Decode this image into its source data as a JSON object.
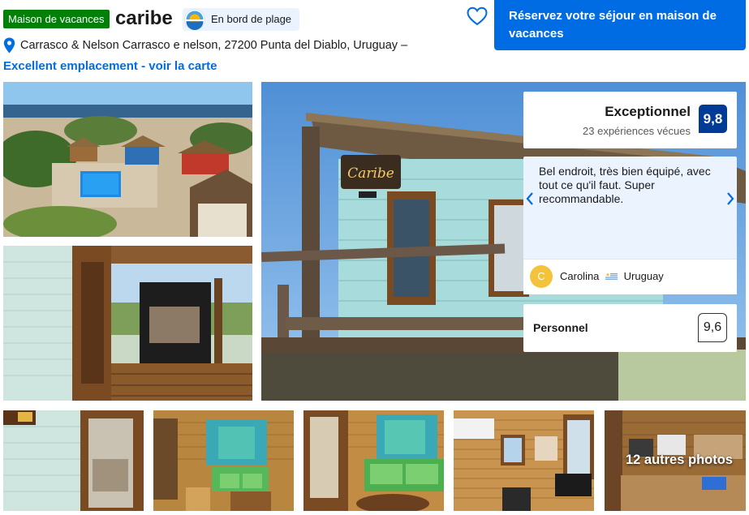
{
  "header": {
    "type_badge": "Maison de vacances",
    "property_name": "caribe",
    "beach_chip": "En bord de plage",
    "address": "Carrasco & Nelson Carrasco e nelson, 27200 Punta del Diablo, Uruguay –",
    "map_link": "Excellent emplacement - voir la carte",
    "reserve_button": "Réservez votre séjour en maison de vacances",
    "icons": [
      "heart-icon",
      "pin-icon",
      "beach-sunset-icon"
    ]
  },
  "gallery": {
    "more_photos_label": "12 autres photos",
    "sign_text": "Caribe"
  },
  "review": {
    "rating_word": "Exceptionnel",
    "review_count": "23 expériences vécues",
    "score": "9,8",
    "quote": "Bel endroit, très bien équipé, avec tout ce qu'il faut. Super recommandable.",
    "reviewer_initial": "C",
    "reviewer_name": "Carolina",
    "reviewer_country": "Uruguay",
    "subscore_label": "Personnel",
    "subscore_value": "9,6"
  },
  "colors": {
    "brand_blue": "#006ce4",
    "score_blue": "#003b95",
    "badge_green": "#008009",
    "review_bg": "#ebf3ff",
    "avatar_yellow": "#f5c33b"
  }
}
